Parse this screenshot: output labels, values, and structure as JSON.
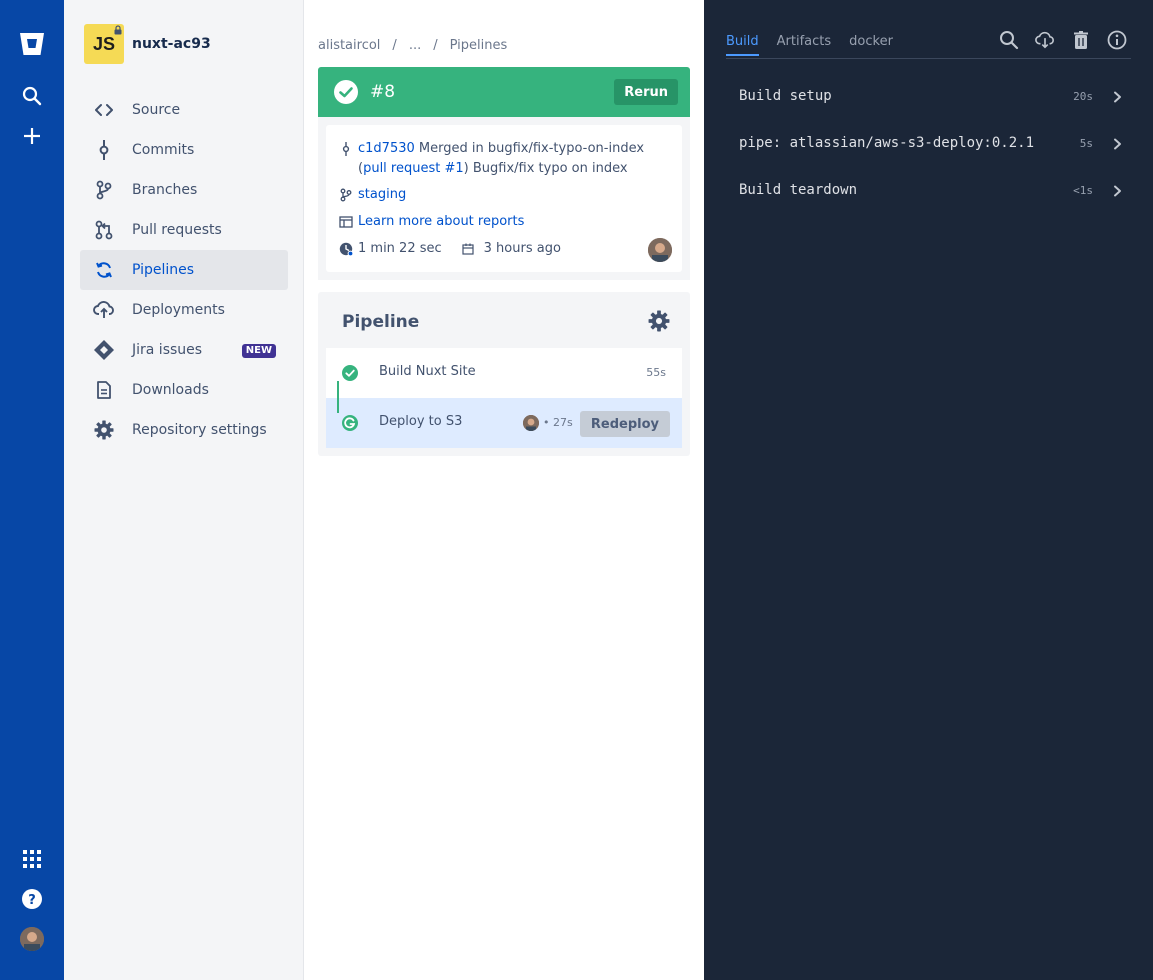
{
  "global_nav": {
    "logo_icon": "bitbucket-logo-icon",
    "items": [
      "search-icon",
      "create-icon"
    ],
    "bottom": [
      "app-switcher-icon",
      "help-icon",
      "profile-avatar"
    ]
  },
  "repo": {
    "avatar_text": "JS",
    "name": "nuxt-ac93"
  },
  "sidebar": {
    "items": [
      {
        "label": "Source",
        "icon": "code-icon"
      },
      {
        "label": "Commits",
        "icon": "commit-icon"
      },
      {
        "label": "Branches",
        "icon": "branch-icon"
      },
      {
        "label": "Pull requests",
        "icon": "pull-request-icon"
      },
      {
        "label": "Pipelines",
        "icon": "pipelines-icon",
        "active": true
      },
      {
        "label": "Deployments",
        "icon": "cloud-upload-icon"
      },
      {
        "label": "Jira issues",
        "icon": "jira-icon",
        "badge": "NEW"
      },
      {
        "label": "Downloads",
        "icon": "document-icon"
      },
      {
        "label": "Repository settings",
        "icon": "gear-icon"
      }
    ]
  },
  "breadcrumb": {
    "owner": "alistaircol",
    "ellipsis": "...",
    "current": "Pipelines"
  },
  "run": {
    "number": "#8",
    "rerun_label": "Rerun",
    "commit_hash": "c1d7530",
    "commit_prefix": "Merged in bugfix/fix-typo-on-index (",
    "pr_link": "pull request #1",
    "commit_suffix": ") Bugfix/fix typo on index",
    "branch": "staging",
    "reports_link": "Learn more about reports",
    "duration": "1 min 22 sec",
    "started": "3 hours ago"
  },
  "pipeline": {
    "title": "Pipeline",
    "steps": [
      {
        "name": "Build Nuxt Site",
        "time": "55s",
        "status": "success"
      },
      {
        "name": "Deploy to S3",
        "time": "• 27s",
        "status": "success",
        "action": "Redeploy"
      }
    ]
  },
  "log": {
    "tabs": [
      "Build",
      "Artifacts",
      "docker"
    ],
    "active_tab": "Build",
    "actions": [
      "search-icon",
      "download-icon",
      "delete-icon",
      "info-icon"
    ],
    "rows": [
      {
        "name": "Build setup",
        "time": "20s"
      },
      {
        "name": "pipe: atlassian/aws-s3-deploy:0.2.1",
        "time": "5s"
      },
      {
        "name": "Build teardown",
        "time": "<1s"
      }
    ]
  },
  "colors": {
    "global_nav": "#0747A6",
    "success": "#36B37E",
    "link": "#0052CC",
    "log_bg": "#1B2638",
    "tab_active": "#4C9AFF"
  }
}
